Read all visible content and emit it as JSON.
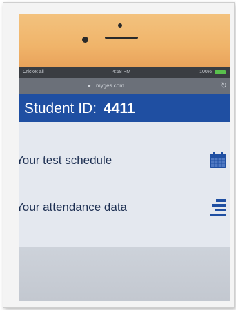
{
  "status_bar": {
    "carrier": "Cricket all",
    "time": "4:58 PM",
    "battery": "100%"
  },
  "browser": {
    "url": "myges.com"
  },
  "header": {
    "label": "Student ID:",
    "student_id": "4411"
  },
  "menu": {
    "items": [
      {
        "label": "Your test schedule",
        "icon": "calendar-icon"
      },
      {
        "label": "Your attendance data",
        "icon": "list-icon"
      }
    ]
  },
  "colors": {
    "header_bg": "#1f4fa2",
    "icon": "#1f4fa2",
    "content_bg": "#e4e8ef",
    "bezel": "#f0b46a"
  }
}
